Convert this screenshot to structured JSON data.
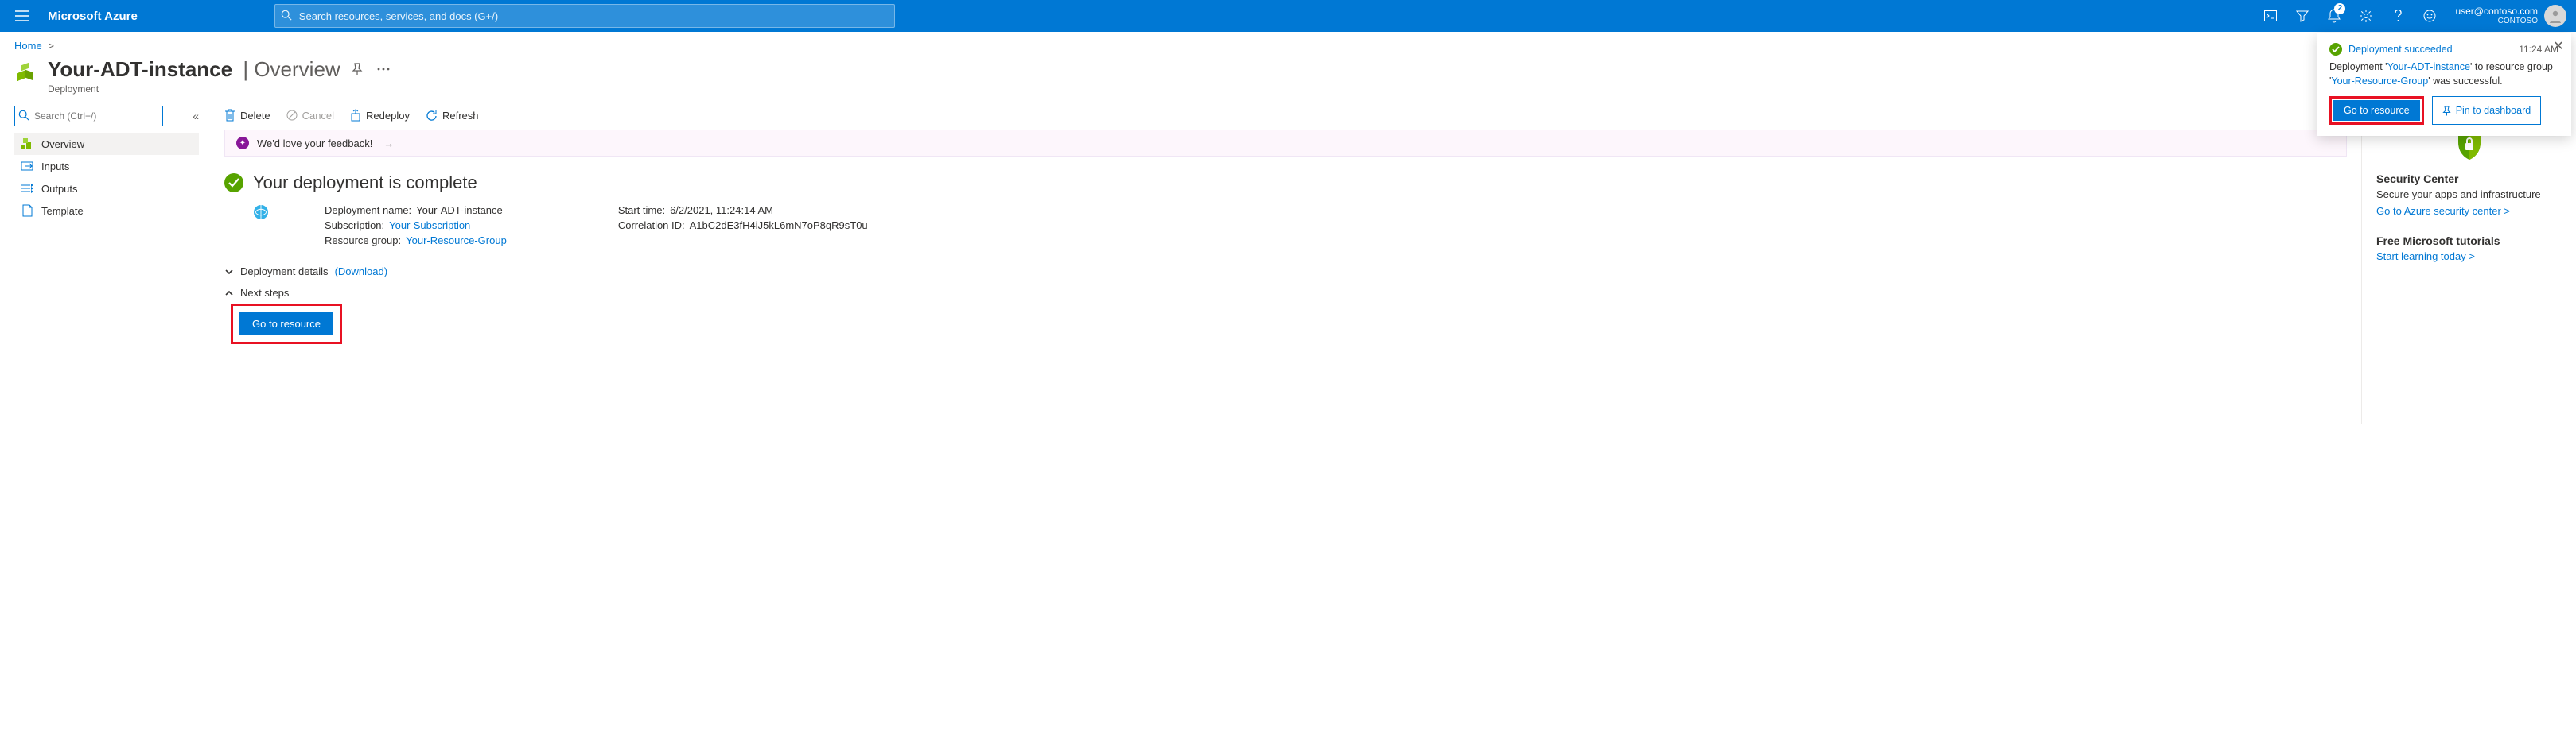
{
  "topbar": {
    "brand": "Microsoft Azure",
    "search_placeholder": "Search resources, services, and docs (G+/)",
    "notification_count": "2",
    "user_email": "user@contoso.com",
    "org": "CONTOSO"
  },
  "breadcrumb": {
    "home": "Home"
  },
  "title": {
    "name": "Your-ADT-instance",
    "section": "Overview",
    "subtitle": "Deployment"
  },
  "sidebar": {
    "search_placeholder": "Search (Ctrl+/)",
    "items": [
      {
        "label": "Overview"
      },
      {
        "label": "Inputs"
      },
      {
        "label": "Outputs"
      },
      {
        "label": "Template"
      }
    ]
  },
  "toolbar": {
    "delete": "Delete",
    "cancel": "Cancel",
    "redeploy": "Redeploy",
    "refresh": "Refresh"
  },
  "feedback": {
    "text": "We'd love your feedback!"
  },
  "status": {
    "heading": "Your deployment is complete",
    "deployment_name_label": "Deployment name:",
    "deployment_name": "Your-ADT-instance",
    "subscription_label": "Subscription:",
    "subscription": "Your-Subscription",
    "resource_group_label": "Resource group:",
    "resource_group": "Your-Resource-Group",
    "start_time_label": "Start time:",
    "start_time": "6/2/2021, 11:24:14 AM",
    "correlation_label": "Correlation ID:",
    "correlation": "A1bC2dE3fH4iJ5kL6mN7oP8qR9sT0u"
  },
  "sections": {
    "deployment_details": "Deployment details",
    "download": "(Download)",
    "next_steps": "Next steps",
    "go_to_resource": "Go to resource"
  },
  "rightpane": {
    "security_title": "Security Center",
    "security_sub": "Secure your apps and infrastructure",
    "security_link": "Go to Azure security center >",
    "tutorials_title": "Free Microsoft tutorials",
    "tutorials_link": "Start learning today >"
  },
  "toast": {
    "title": "Deployment succeeded",
    "time": "11:24 AM",
    "body_prefix": "Deployment '",
    "body_name": "Your-ADT-instance",
    "body_mid": "' to resource group '",
    "body_rg": "Your-Resource-Group",
    "body_suffix": "' was successful.",
    "go_to_resource": "Go to resource",
    "pin_to_dashboard": "Pin to dashboard"
  }
}
